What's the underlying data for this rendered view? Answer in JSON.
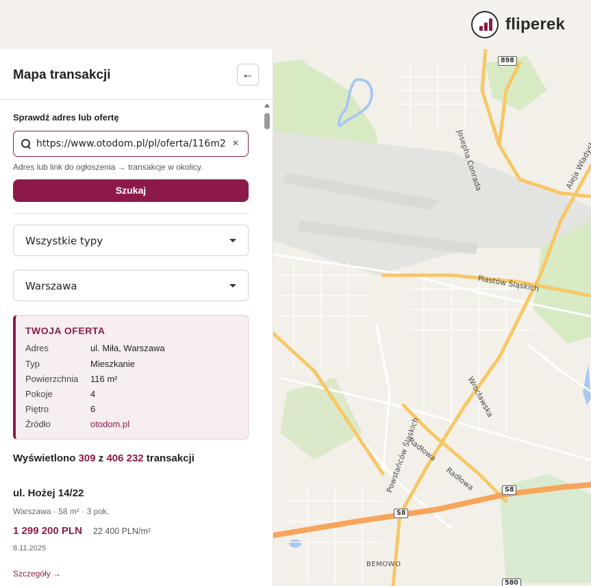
{
  "brand": {
    "name": "fliperek"
  },
  "sidebar": {
    "title": "Mapa transakcji",
    "back_icon": "←",
    "search": {
      "label": "Sprawdź adres lub ofertę",
      "value": "https://www.otodom.pl/pl/oferta/116m2",
      "placeholder": "",
      "clear_icon": "×",
      "hint": "Adres lub link do ogłoszenia → transakcje w okolicy.",
      "button": "Szukaj"
    },
    "filters": {
      "type": "Wszystkie typy",
      "city": "Warszawa"
    },
    "offer": {
      "heading": "TWOJA OFERTA",
      "rows": [
        {
          "k": "Adres",
          "v": "ul. Miła, Warszawa"
        },
        {
          "k": "Typ",
          "v": "Mieszkanie"
        },
        {
          "k": "Powierzchnia",
          "v": "116 m²"
        },
        {
          "k": "Pokoje",
          "v": "4"
        },
        {
          "k": "Piętro",
          "v": "6"
        },
        {
          "k": "Źródło",
          "v": "otodom.pl"
        }
      ]
    },
    "results": {
      "prefix": "Wyświetlono",
      "shown": "309",
      "sep": "z",
      "total": "406 232",
      "suffix": "transakcji"
    },
    "transaction": {
      "title": "ul. Hożej 14/22",
      "meta": "Warszawa · 58 m² · 3 pok.",
      "price": "1 299 200 PLN",
      "ppm": "22 400 PLN/m²",
      "date": "8.11.2025",
      "link": "Szczegóły →"
    }
  },
  "map": {
    "labels": {
      "conrada": "Josepha Conrada",
      "wladyslawa": "Aleja Władysława",
      "piastow": "Piastów Śląskich",
      "wroclawska": "Wrocławska",
      "powstancow": "Powstańców Śląskich",
      "radlowa1": "Radłowa",
      "radlowa2": "Radłowa",
      "bemowo": "BEMOWO"
    },
    "badges": {
      "r898": "898",
      "s8a": "S8",
      "s8b": "S8",
      "r580": "580"
    },
    "colors": {
      "major_road": "#f7c766",
      "motorway": "#f6a55a",
      "park": "#d7eac4",
      "water": "#a8c8f0",
      "airfield": "#e3e4e0"
    }
  }
}
